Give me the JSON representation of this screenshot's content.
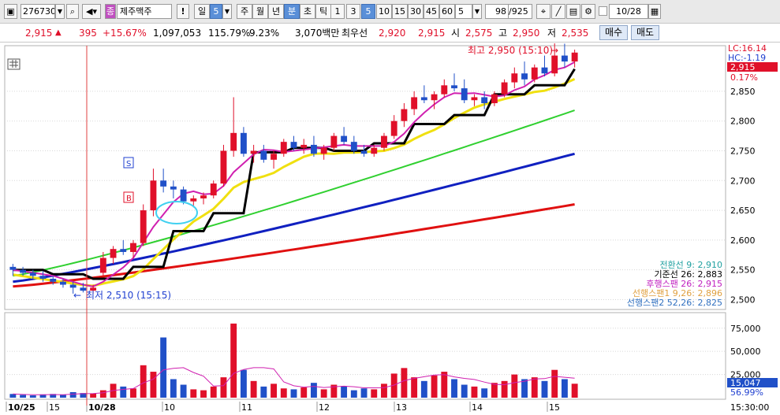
{
  "toolbar": {
    "code": "276730",
    "name": "제주맥주",
    "name_badge": "종",
    "excl": "!",
    "period_day": "일",
    "period_num": "5",
    "periods": [
      "주",
      "월",
      "년"
    ],
    "active_min": "분",
    "cho": "초",
    "tick": "틱",
    "intervals": [
      "1",
      "3",
      "5",
      "10",
      "15",
      "30",
      "45",
      "60"
    ],
    "active_interval": "5",
    "count_sel": "5",
    "count": "98",
    "total": "/925",
    "date": "10/28"
  },
  "quote": {
    "price": "2,915",
    "arrow": "▲",
    "change": "395",
    "change_pct": "+15.67%",
    "volume": "1,097,053",
    "vol_ratio": "115.79%",
    "turnover": "9.23%",
    "amount": "3,070백만",
    "best_ask_label": "최우선",
    "best_ask": "2,920",
    "best_bid": "2,915",
    "open_label": "시",
    "open": "2,575",
    "high_label": "고",
    "high": "2,950",
    "low_label": "저",
    "low": "2,535",
    "buy_label": "매수",
    "sell_label": "매도"
  },
  "price_axis": {
    "ticks": [
      "2,850",
      "2,800",
      "2,750",
      "2,700",
      "2,650",
      "2,600",
      "2,550",
      "2,500"
    ],
    "lc": "LC:16.14",
    "hc": "HC:-1.19",
    "current": "2,915",
    "current_pct": "0.17%"
  },
  "volume_axis": {
    "ticks": [
      "75,000",
      "50,000",
      "25,000"
    ],
    "current": "15,047",
    "current_pct": "56.99%"
  },
  "time_axis": {
    "labels": [
      "10/25",
      "15",
      "10/28",
      "10",
      "11",
      "12",
      "13",
      "14",
      "15"
    ],
    "time": "15:30:00"
  },
  "annotations": {
    "high": "최고 2,950 (15:10)",
    "low": "최저 2,510 (15:15)",
    "marker_s": "S",
    "marker_b": "B"
  },
  "ichimoku_legend": [
    {
      "text": "전환선 9: 2,910",
      "color": "#20a0a0"
    },
    {
      "text": "기준선 26: 2,883",
      "color": "#000000"
    },
    {
      "text": "후행스팬 26: 2,915",
      "color": "#c020c0"
    },
    {
      "text": "선행스팬1 9,26: 2,896",
      "color": "#e0a040"
    },
    {
      "text": "선행스팬2 52,26: 2,825",
      "color": "#3070c0"
    }
  ],
  "colors": {
    "up": "#e0102a",
    "down": "#2050c8",
    "ma5": "#d020b0",
    "ma20": "#f0e010",
    "ma60": "#30d030",
    "ma120": "#1020c0",
    "ma240": "#e01010",
    "kijun": "#000000"
  },
  "chart_data": {
    "type": "candlestick",
    "price_ylim": [
      2490,
      2920
    ],
    "volume_ylim": [
      0,
      85000
    ],
    "candles": [
      [
        2555,
        2560,
        2540,
        2550
      ],
      [
        2550,
        2555,
        2540,
        2545
      ],
      [
        2545,
        2550,
        2535,
        2540
      ],
      [
        2540,
        2548,
        2530,
        2535
      ],
      [
        2535,
        2540,
        2525,
        2530
      ],
      [
        2530,
        2535,
        2520,
        2525
      ],
      [
        2525,
        2530,
        2510,
        2520
      ],
      [
        2520,
        2528,
        2512,
        2515
      ],
      [
        2515,
        2525,
        2510,
        2520
      ],
      [
        2545,
        2580,
        2540,
        2570
      ],
      [
        2570,
        2590,
        2560,
        2585
      ],
      [
        2585,
        2600,
        2575,
        2580
      ],
      [
        2580,
        2600,
        2570,
        2595
      ],
      [
        2595,
        2660,
        2590,
        2650
      ],
      [
        2650,
        2720,
        2640,
        2700
      ],
      [
        2700,
        2720,
        2680,
        2690
      ],
      [
        2690,
        2700,
        2670,
        2685
      ],
      [
        2685,
        2690,
        2660,
        2665
      ],
      [
        2665,
        2675,
        2655,
        2670
      ],
      [
        2670,
        2680,
        2660,
        2675
      ],
      [
        2675,
        2700,
        2670,
        2695
      ],
      [
        2695,
        2760,
        2690,
        2750
      ],
      [
        2750,
        2840,
        2740,
        2780
      ],
      [
        2780,
        2790,
        2740,
        2745
      ],
      [
        2745,
        2760,
        2730,
        2750
      ],
      [
        2750,
        2760,
        2730,
        2735
      ],
      [
        2735,
        2750,
        2720,
        2745
      ],
      [
        2745,
        2770,
        2740,
        2765
      ],
      [
        2765,
        2775,
        2750,
        2755
      ],
      [
        2755,
        2770,
        2745,
        2760
      ],
      [
        2760,
        2775,
        2740,
        2745
      ],
      [
        2745,
        2760,
        2735,
        2755
      ],
      [
        2755,
        2780,
        2750,
        2775
      ],
      [
        2775,
        2790,
        2760,
        2765
      ],
      [
        2765,
        2775,
        2745,
        2750
      ],
      [
        2750,
        2760,
        2740,
        2745
      ],
      [
        2745,
        2760,
        2740,
        2755
      ],
      [
        2755,
        2780,
        2750,
        2775
      ],
      [
        2775,
        2810,
        2770,
        2800
      ],
      [
        2800,
        2830,
        2790,
        2820
      ],
      [
        2820,
        2850,
        2810,
        2840
      ],
      [
        2840,
        2860,
        2830,
        2835
      ],
      [
        2835,
        2850,
        2820,
        2845
      ],
      [
        2845,
        2870,
        2840,
        2860
      ],
      [
        2860,
        2880,
        2850,
        2855
      ],
      [
        2855,
        2870,
        2830,
        2835
      ],
      [
        2835,
        2845,
        2825,
        2840
      ],
      [
        2840,
        2850,
        2820,
        2830
      ],
      [
        2830,
        2850,
        2825,
        2845
      ],
      [
        2845,
        2870,
        2840,
        2865
      ],
      [
        2865,
        2890,
        2855,
        2880
      ],
      [
        2880,
        2900,
        2860,
        2870
      ],
      [
        2870,
        2895,
        2865,
        2890
      ],
      [
        2890,
        2910,
        2875,
        2880
      ],
      [
        2880,
        2950,
        2875,
        2910
      ],
      [
        2910,
        2930,
        2890,
        2900
      ],
      [
        2900,
        2920,
        2890,
        2915
      ]
    ],
    "volumes": [
      4000,
      3000,
      2500,
      3500,
      4000,
      3000,
      6000,
      5000,
      4500,
      8000,
      15000,
      12000,
      10000,
      35000,
      28000,
      65000,
      20000,
      14000,
      9000,
      8000,
      12000,
      22000,
      80000,
      30000,
      18000,
      12000,
      15000,
      10000,
      9000,
      11000,
      16000,
      9000,
      14000,
      12000,
      8000,
      10000,
      9000,
      15000,
      26000,
      32000,
      22000,
      18000,
      24000,
      28000,
      20000,
      14000,
      12000,
      10000,
      16000,
      18000,
      25000,
      20000,
      22000,
      18000,
      30000,
      20000,
      15047
    ]
  }
}
